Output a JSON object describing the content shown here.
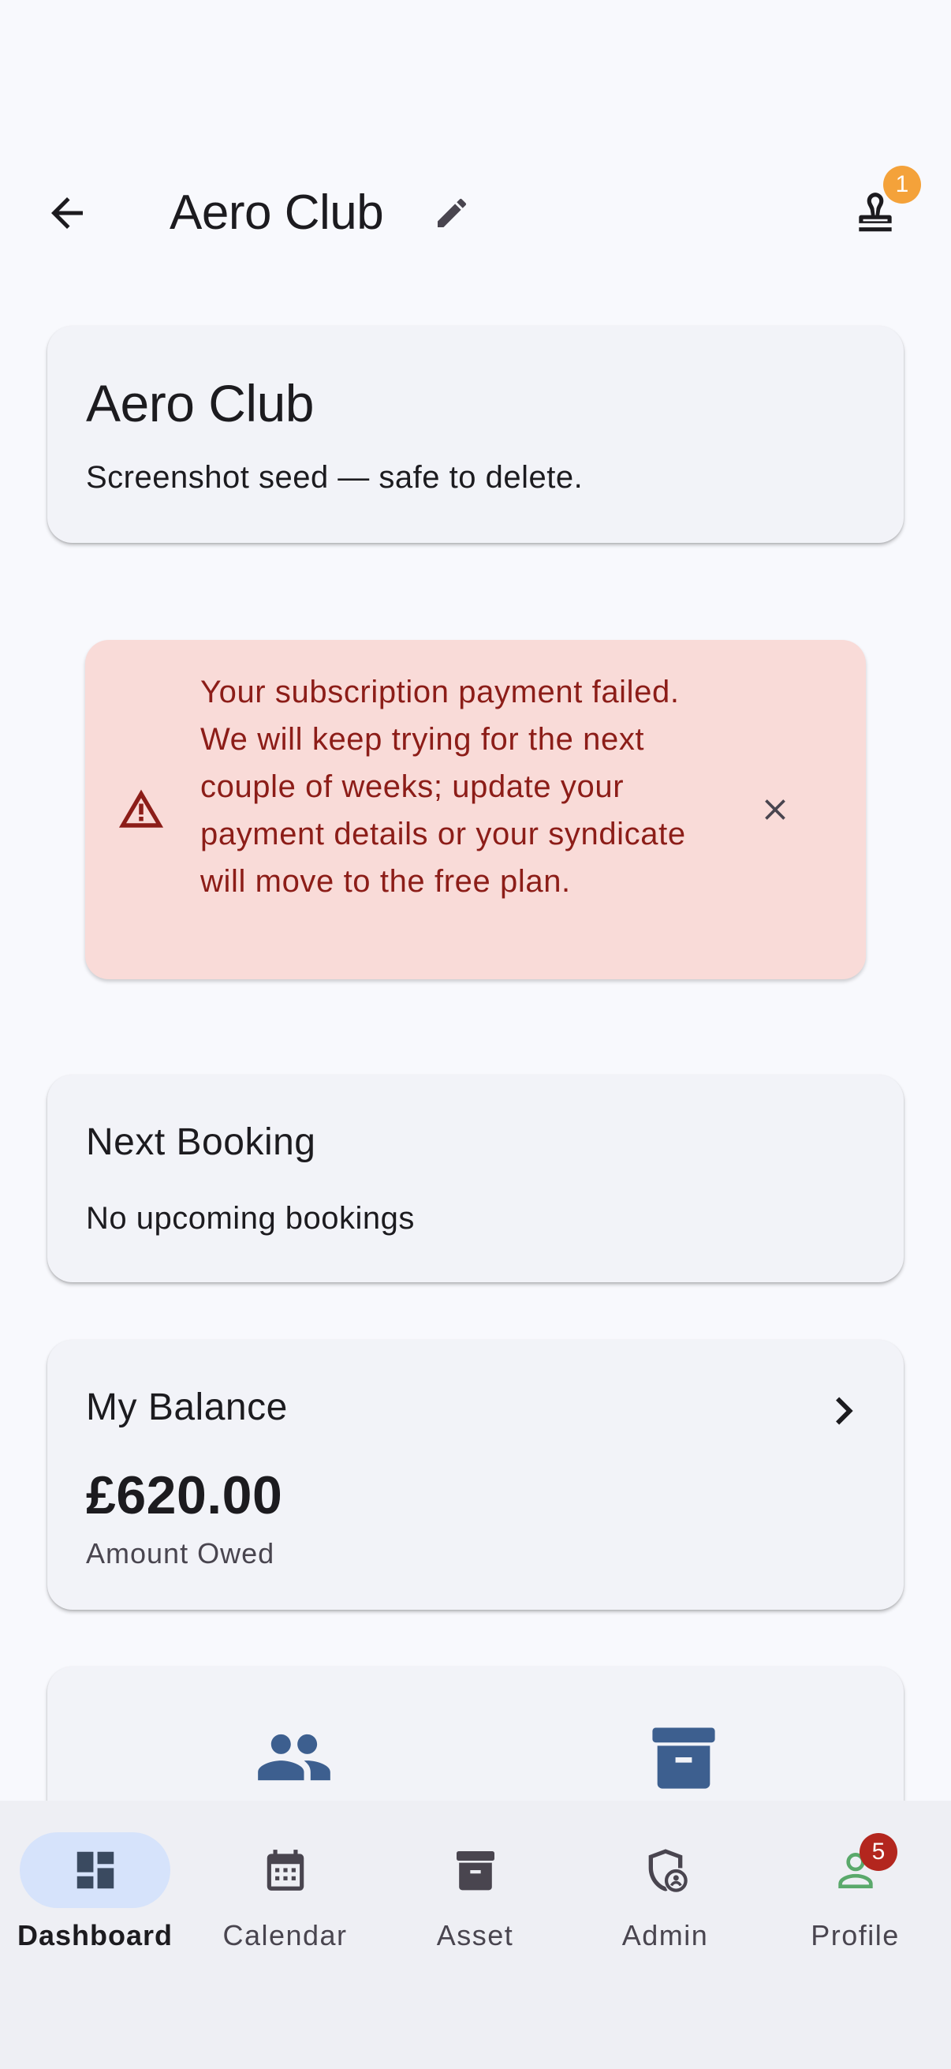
{
  "app_bar": {
    "title": "Aero Club",
    "notification_count": "1"
  },
  "header_card": {
    "title": "Aero Club",
    "subtitle": "Screenshot seed — safe to delete."
  },
  "alert": {
    "message": "Your subscription payment failed. We will keep trying for the next couple of weeks; update your payment details or your syndicate will move to the free plan."
  },
  "next_booking": {
    "title": "Next Booking",
    "text": "No upcoming bookings"
  },
  "balance": {
    "title": "My Balance",
    "amount": "£620.00",
    "label": "Amount Owed"
  },
  "bottom_nav": {
    "items": [
      {
        "label": "Dashboard",
        "icon": "dashboard-icon",
        "active": true
      },
      {
        "label": "Calendar",
        "icon": "calendar-icon"
      },
      {
        "label": "Asset",
        "icon": "archive-icon"
      },
      {
        "label": "Admin",
        "icon": "admin-shield-icon"
      },
      {
        "label": "Profile",
        "icon": "person-icon"
      }
    ],
    "profile_badge": "5"
  },
  "colors": {
    "accent": "#3d5f8f",
    "alert_bg": "#f9dbd8",
    "alert_text": "#8c1d18",
    "badge_orange": "#f4a23a",
    "badge_red": "#b3261e",
    "nav_active": "#d6e3fb",
    "profile_green": "#5aa96b"
  }
}
